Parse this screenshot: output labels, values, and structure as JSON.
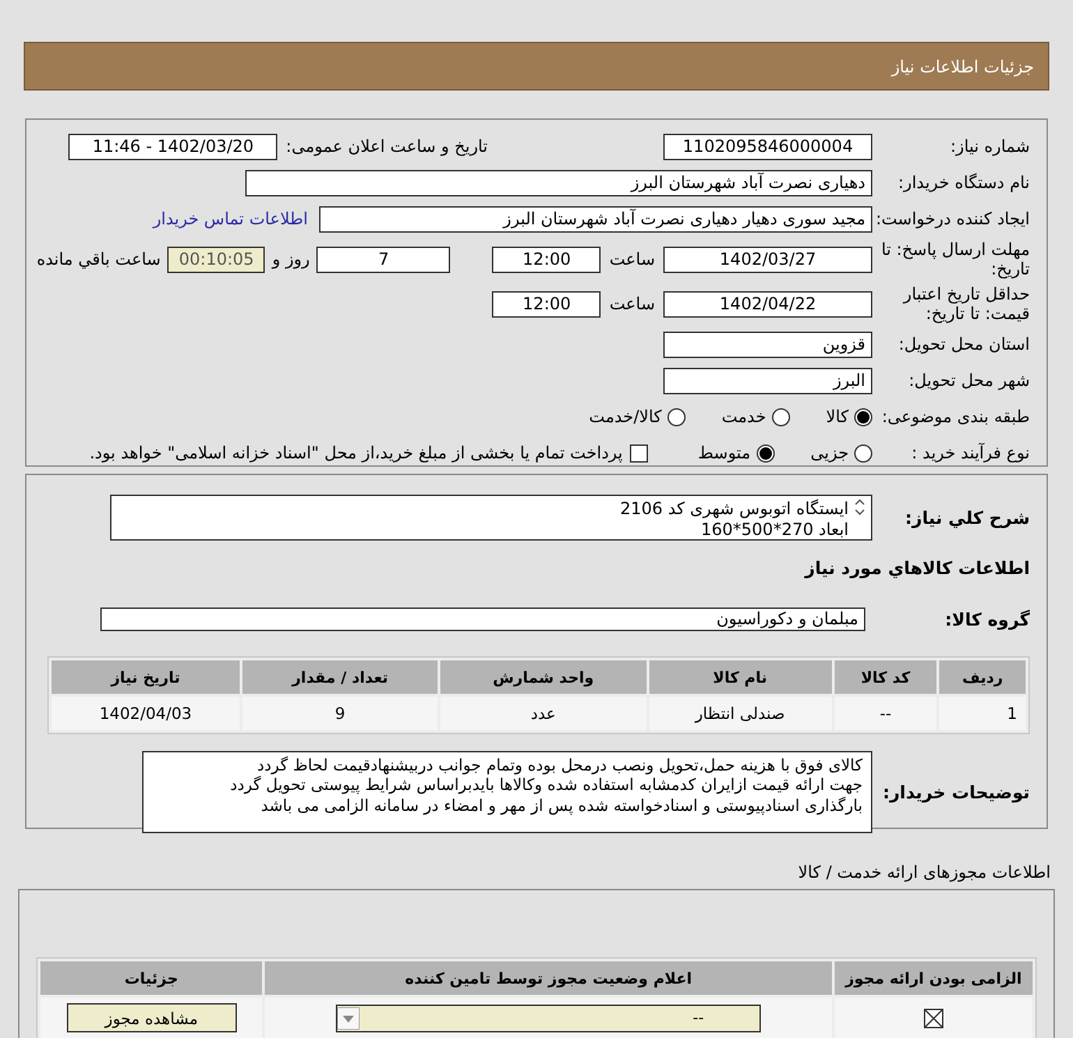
{
  "header": {
    "title": "جزئیات اطلاعات نیاز"
  },
  "need_number": {
    "label": "شماره نیاز:",
    "value": "1102095846000004"
  },
  "announce": {
    "label": "تاریخ و ساعت اعلان عمومی:",
    "value": "1402/03/20 - 11:46"
  },
  "buyer_org": {
    "label": "نام دستگاه خریدار:",
    "value": "دهیاری نصرت آباد شهرستان البرز"
  },
  "requester": {
    "label": "ایجاد کننده درخواست:",
    "value": "مجید سوری دهیار دهیاری نصرت آباد شهرستان البرز",
    "contact_link": "اطلاعات تماس خریدار"
  },
  "reply_deadline": {
    "label": "مهلت ارسال پاسخ: تا تاریخ:",
    "date": "1402/03/27",
    "time_label": "ساعت",
    "time": "12:00",
    "days": "7",
    "days_label": "روز و",
    "remaining": "00:10:05",
    "remaining_label": "ساعت باقي مانده"
  },
  "price_validity": {
    "label": "حداقل تاریخ اعتبار قیمت: تا تاریخ:",
    "date": "1402/04/22",
    "time_label": "ساعت",
    "time": "12:00"
  },
  "province": {
    "label": "استان محل تحویل:",
    "value": "قزوین"
  },
  "city": {
    "label": "شهر محل تحویل:",
    "value": "البرز"
  },
  "category": {
    "label": "طبقه بندی موضوعی:",
    "options": [
      {
        "label": "کالا",
        "selected": true
      },
      {
        "label": "خدمت",
        "selected": false
      },
      {
        "label": "کالا/خدمت",
        "selected": false
      }
    ]
  },
  "purchase_type": {
    "label": "نوع فرآیند خرید :",
    "options": [
      {
        "label": "جزیی",
        "selected": false
      },
      {
        "label": "متوسط",
        "selected": true
      }
    ],
    "treasury": {
      "label": "پرداخت تمام یا بخشی از مبلغ خرید،از محل \"اسناد خزانه اسلامی\" خواهد بود.",
      "checked": false
    }
  },
  "description": {
    "label": "شرح کلي نیاز:",
    "lines": [
      "ایستگاه اتوبوس شهری کد 2106",
      "ابعاد 270*500*160"
    ]
  },
  "goods_heading": "اطلاعات كالاهاي مورد نياز",
  "goods_group": {
    "label": "گروه کالا:",
    "value": "مبلمان و دکوراسیون"
  },
  "goods_table": {
    "columns": [
      "ردیف",
      "کد کالا",
      "نام کالا",
      "واحد شمارش",
      "تعداد / مقدار",
      "تاریخ نیاز"
    ],
    "rows": [
      [
        "1",
        "--",
        "صندلی انتظار",
        "عدد",
        "9",
        "1402/04/03"
      ]
    ]
  },
  "buyer_notes": {
    "label": "توضیحات خریدار:",
    "lines": [
      "کالای فوق با هزینه حمل،تحویل ونصب درمحل بوده وتمام جوانب دربیشنهادقیمت لحاظ گردد",
      "جهت ارائه قیمت ازایران کدمشابه استفاده شده وکالاها بایدبراساس شرایط پیوستی تحویل گردد",
      "بارگذاری اسنادپیوستی و اسنادخواسته شده پس از مهر و امضاء در سامانه الزامی می باشد"
    ]
  },
  "licenses": {
    "heading": "اطلاعات مجوزهای ارائه خدمت / کالا",
    "columns": [
      "الزامی بودن ارائه مجوز",
      "اعلام وضعیت مجوز توسط تامین کننده",
      "جزئیات"
    ],
    "rows": [
      {
        "required": true,
        "status": "--",
        "details_button": "مشاهده مجوز"
      }
    ]
  }
}
